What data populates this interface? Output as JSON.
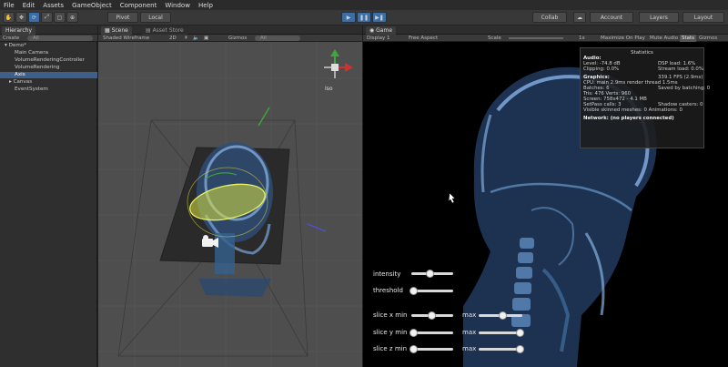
{
  "menu": [
    "File",
    "Edit",
    "Assets",
    "GameObject",
    "Component",
    "Window",
    "Help"
  ],
  "toolbar": {
    "pivot": "Pivot",
    "local": "Local",
    "collab": "Collab",
    "account": "Account",
    "layers": "Layers",
    "layout": "Layout"
  },
  "hierarchy": {
    "tab": "Hierarchy",
    "create": "Create",
    "search_placeholder": "All",
    "scene_name": "Demo*",
    "items": [
      "Main Camera",
      "VolumeRenderingController",
      "VolumeRendering",
      "Axis",
      "Canvas",
      "EventSystem"
    ],
    "selected_index": 3
  },
  "scene": {
    "tab": "Scene",
    "tab2": "Asset Store",
    "shading": "Shaded Wireframe",
    "mode": "2D",
    "gizmos": "Gizmos",
    "search": "All",
    "persp": "Iso"
  },
  "game": {
    "tab": "Game",
    "display": "Display 1",
    "aspect": "Free Aspect",
    "scale": "Scale",
    "scale_value": "1x",
    "maximize": "Maximize On Play",
    "mute": "Mute Audio",
    "stats": "Stats",
    "gizmos": "Gizmos"
  },
  "statistics": {
    "title": "Statistics",
    "audio": "Audio:",
    "level": "Level: -74.8 dB",
    "clipping": "Clipping: 0.0%",
    "dsp": "DSP load: 1.6%",
    "stream": "Stream load: 0.0%",
    "graphics": "Graphics:",
    "fps": "339.1 FPS (2.9ms)",
    "cpu": "CPU: main 2.9ms  render thread 1.5ms",
    "batches": "Batches: 6",
    "saved": "Saved by batching: 0",
    "tris": "Tris: 476  Verts: 960",
    "screen": "Screen: 758x472 - 4.1 MB",
    "setpass": "SetPass calls: 3",
    "shadow": "Shadow casters: 0",
    "skinned": "Visible skinned meshes: 0  Animations: 0",
    "network": "Network: (no players connected)"
  },
  "controls": {
    "intensity": {
      "label": "intensity",
      "value": 0.45
    },
    "threshold": {
      "label": "threshold",
      "value": 0.05
    },
    "slice_x": {
      "label": "slice x min",
      "min": 0.48,
      "max_label": "max",
      "max": 0.55
    },
    "slice_y": {
      "label": "slice y min",
      "min": 0.05,
      "max_label": "max",
      "max": 0.95
    },
    "slice_z": {
      "label": "slice z min",
      "min": 0.05,
      "max_label": "max",
      "max": 0.95
    }
  },
  "colors": {
    "accent": "#3b6ea5",
    "selection": "#3e5f8a",
    "bone": "#8fb8e8",
    "gizmo_yellow": "#d8e040"
  }
}
